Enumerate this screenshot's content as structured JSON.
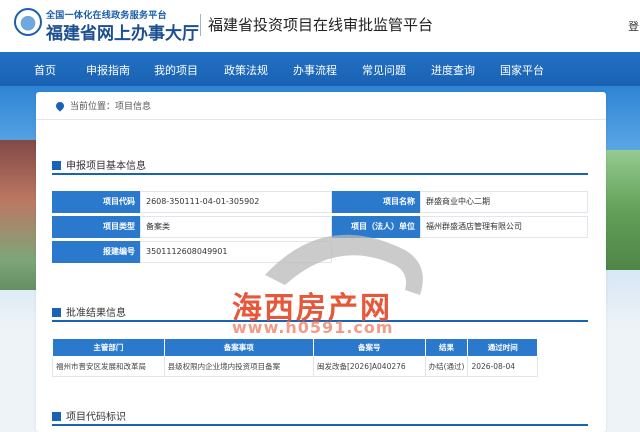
{
  "header": {
    "brand_top": "全国一体化在线政务服务平台",
    "brand_main": "福建省网上办事大厅",
    "platform_title": "福建省投资项目在线审批监管平台",
    "login_fragment": "登"
  },
  "nav": [
    "首页",
    "申报指南",
    "我的项目",
    "政策法规",
    "办事流程",
    "常见问题",
    "进度查询",
    "国家平台"
  ],
  "breadcrumb": "当前位置：项目信息",
  "sections": {
    "basic": "申报项目基本信息",
    "result": "批准结果信息",
    "code": "项目代码标识"
  },
  "project_info": {
    "code_label": "项目代码",
    "code_value": "2608-350111-04-01-305902",
    "name_label": "项目名称",
    "name_value": "群盛商业中心二期",
    "type_label": "项目类型",
    "type_value": "备案类",
    "unit_label": "项目（法人）单位",
    "unit_value": "福州群盛酒店管理有限公司",
    "report_label": "报建编号",
    "report_value": "3501112608049901"
  },
  "result_table": {
    "headers": [
      "主管部门",
      "备案事项",
      "备案号",
      "结果",
      "通过时间"
    ],
    "rows": [
      [
        "福州市晋安区发展和改革局",
        "县级权限内企业境内投资项目备案",
        "闽发改备[2026]A040276",
        "办结(通过)",
        "2026-08-04"
      ]
    ]
  },
  "watermark": {
    "title": "海西房产网",
    "url": "www.h0591.com"
  },
  "colors": {
    "primary": "#1a62b3",
    "table_header": "#2a79cc",
    "watermark": "#e64a2a"
  }
}
